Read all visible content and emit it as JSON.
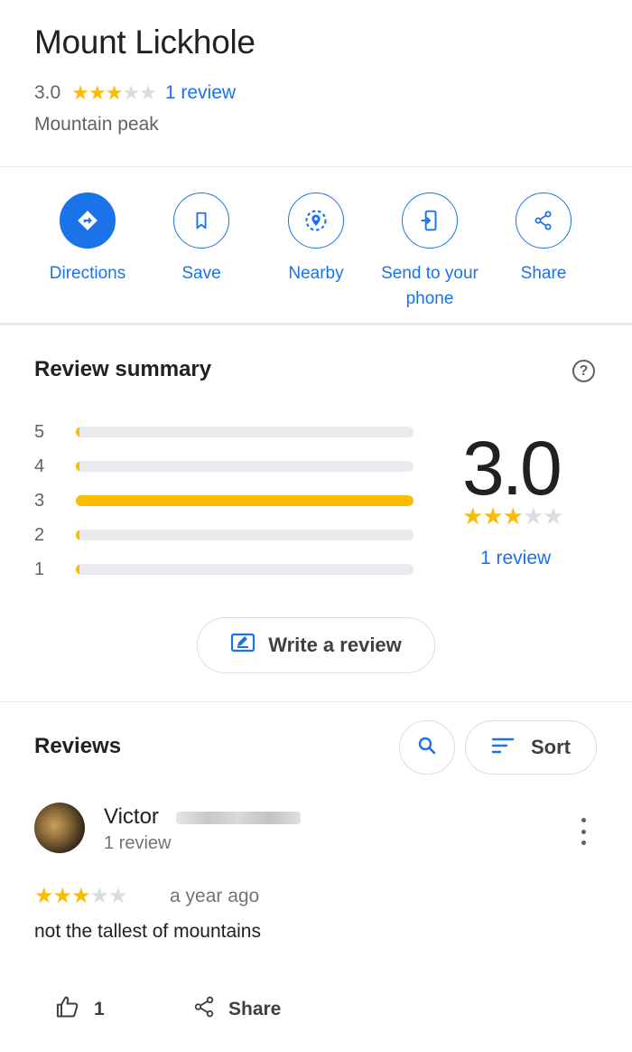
{
  "place": {
    "name": "Mount Lickhole",
    "rating": "3.0",
    "rating_value": 3,
    "review_count_label": "1 review",
    "category": "Mountain peak"
  },
  "actions": [
    {
      "label": "Directions",
      "icon": "directions-icon"
    },
    {
      "label": "Save",
      "icon": "bookmark-icon"
    },
    {
      "label": "Nearby",
      "icon": "nearby-icon"
    },
    {
      "label": "Send to your phone",
      "icon": "send-to-phone-icon"
    },
    {
      "label": "Share",
      "icon": "share-icon"
    }
  ],
  "summary": {
    "title": "Review summary",
    "help_icon": "help-icon",
    "distribution": [
      {
        "stars": "5",
        "fraction": 0
      },
      {
        "stars": "4",
        "fraction": 0
      },
      {
        "stars": "3",
        "fraction": 1
      },
      {
        "stars": "2",
        "fraction": 0
      },
      {
        "stars": "1",
        "fraction": 0
      }
    ],
    "score": "3.0",
    "score_value": 3,
    "review_link": "1 review",
    "write_review_label": "Write a review"
  },
  "reviews": {
    "title": "Reviews",
    "sort_label": "Sort",
    "items": [
      {
        "author": "Victor",
        "author_meta": "1 review",
        "rating": 3,
        "time": "a year ago",
        "text": "not the tallest of mountains",
        "likes": "1",
        "share_label": "Share"
      }
    ]
  },
  "colors": {
    "accent": "#1a73e8",
    "star": "#fbbc04",
    "star_empty": "#dadce0",
    "divider": "#e8eaed"
  }
}
